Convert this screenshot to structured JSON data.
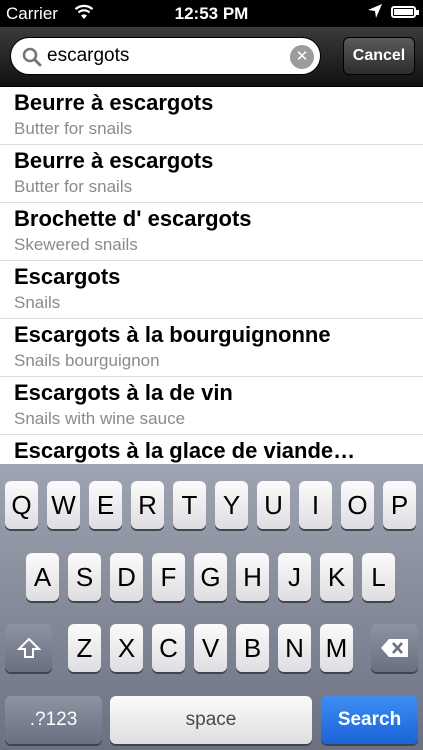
{
  "status_bar": {
    "carrier": "Carrier",
    "time": "12:53 PM",
    "icons": [
      "wifi-icon",
      "location-icon",
      "battery-icon"
    ]
  },
  "search": {
    "value": "escargots",
    "cancel_label": "Cancel",
    "icons": [
      "magnifier-icon",
      "clear-icon"
    ]
  },
  "results": [
    {
      "title": "Beurre à escargots",
      "subtitle": "Butter for snails"
    },
    {
      "title": "Beurre à escargots",
      "subtitle": "Butter for snails"
    },
    {
      "title": "Brochette d' escargots",
      "subtitle": "Skewered snails"
    },
    {
      "title": "Escargots",
      "subtitle": "Snails"
    },
    {
      "title": "Escargots à la bourguignonne",
      "subtitle": "Snails bourguignon"
    },
    {
      "title": "Escargots à la de vin",
      "subtitle": "Snails with wine sauce"
    },
    {
      "title": "Escargots à la glace de viande…",
      "subtitle": ""
    }
  ],
  "keyboard": {
    "row1": [
      "Q",
      "W",
      "E",
      "R",
      "T",
      "Y",
      "U",
      "I",
      "O",
      "P"
    ],
    "row2": [
      "A",
      "S",
      "D",
      "F",
      "G",
      "H",
      "J",
      "K",
      "L"
    ],
    "row3": [
      "Z",
      "X",
      "C",
      "V",
      "B",
      "N",
      "M"
    ],
    "numbers_label": ".?123",
    "space_label": "space",
    "search_label": "Search",
    "icons": [
      "shift-icon",
      "backspace-icon"
    ]
  },
  "colors": {
    "search_key": "#1b63d9",
    "subtitle": "#8a8a8a"
  }
}
